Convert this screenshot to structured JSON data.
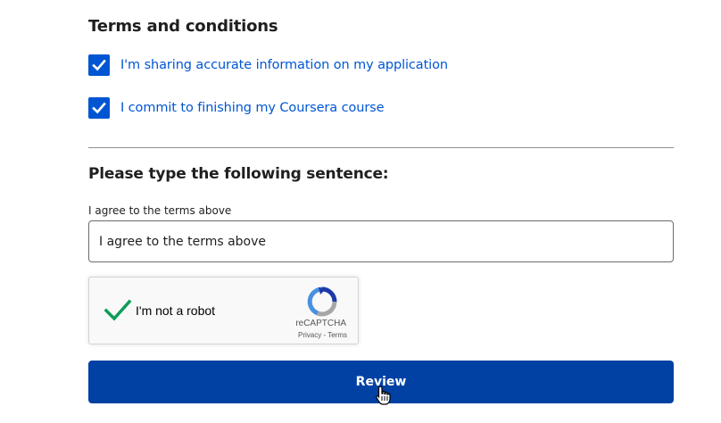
{
  "terms": {
    "title": "Terms and conditions",
    "items": [
      {
        "label": "I'm sharing accurate information on my application",
        "checked": true
      },
      {
        "label": "I commit to finishing my Coursera course",
        "checked": true
      }
    ]
  },
  "sentence": {
    "title": "Please type the following sentence:",
    "field_label": "I agree to the terms above",
    "value": "I agree to the terms above"
  },
  "recaptcha": {
    "label": "I'm not a robot",
    "brand": "reCAPTCHA",
    "privacy": "Privacy",
    "separator": "-",
    "terms": "Terms",
    "verified": true
  },
  "actions": {
    "review_label": "Review"
  },
  "colors": {
    "accent": "#0056d2",
    "button": "#0041a3",
    "check_green": "#0f9d58"
  }
}
